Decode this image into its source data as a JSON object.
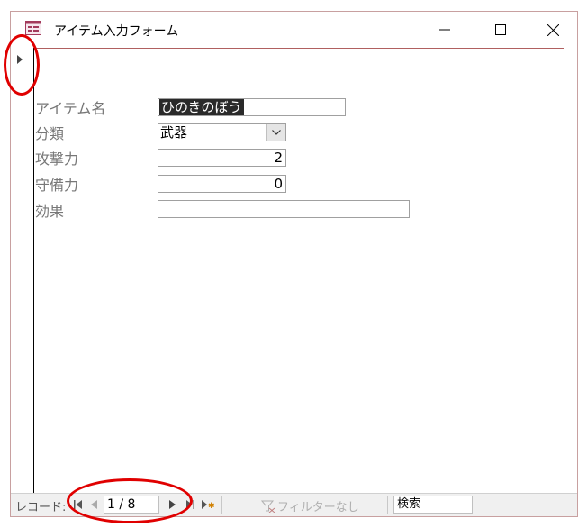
{
  "window": {
    "title": "アイテム入力フォーム"
  },
  "form": {
    "fields": [
      {
        "label": "アイテム名",
        "value": "ひのきのぼう"
      },
      {
        "label": "分類",
        "value": "武器"
      },
      {
        "label": "攻撃力",
        "value": "2"
      },
      {
        "label": "守備力",
        "value": "0"
      },
      {
        "label": "効果",
        "value": ""
      }
    ]
  },
  "navigation": {
    "record_label": "レコード:",
    "record_position": "1 / 8",
    "filter_label": "フィルターなし",
    "search_label": "検索"
  },
  "colors": {
    "annotation": "#e00000",
    "selection": "#2a2a2a"
  }
}
